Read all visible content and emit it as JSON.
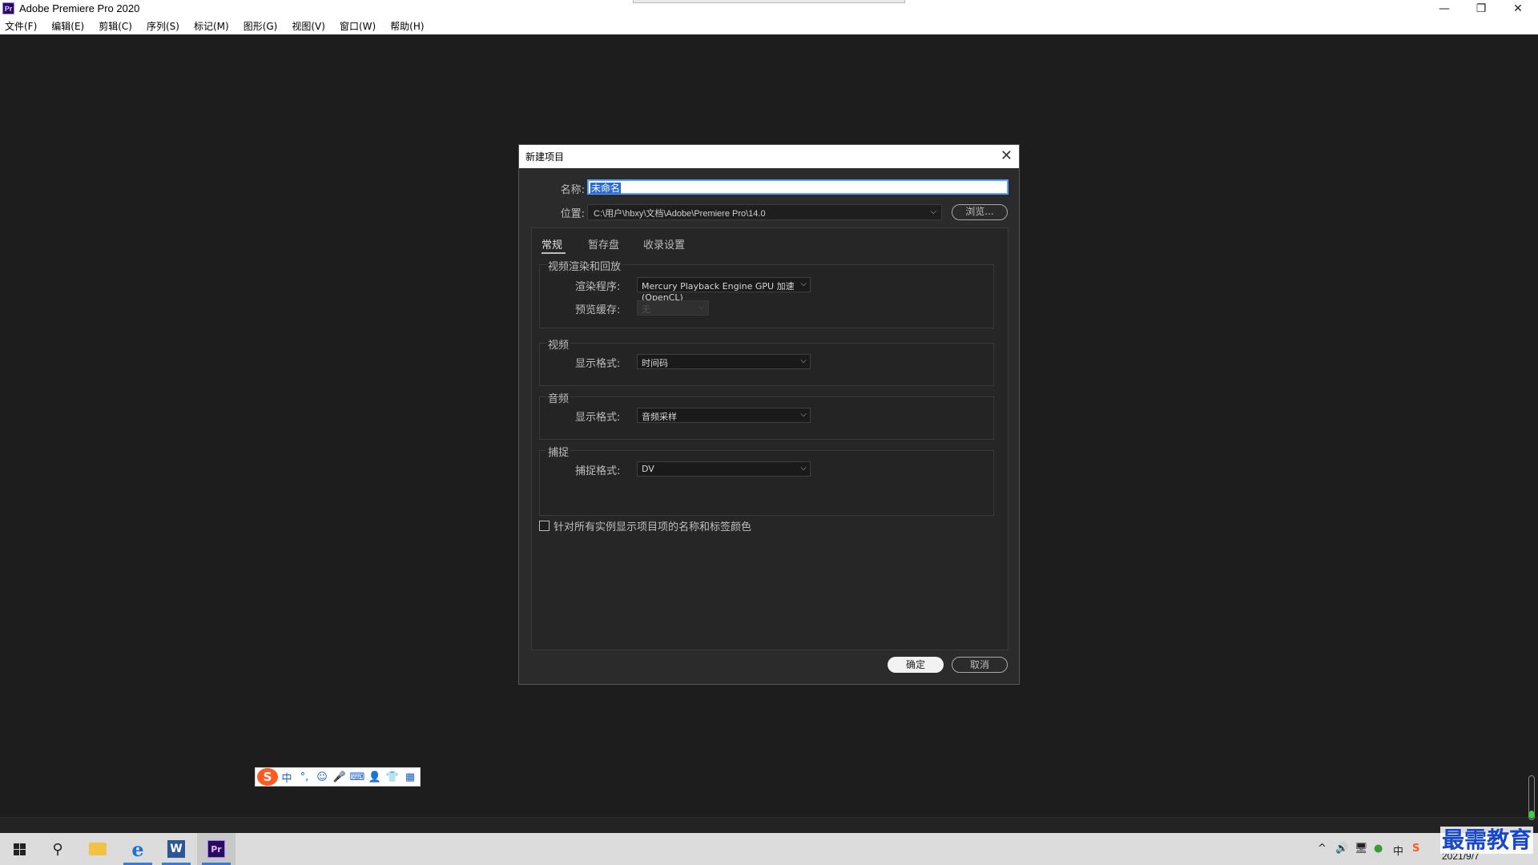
{
  "app": {
    "title": "Adobe Premiere Pro 2020",
    "logo_text": "Pr"
  },
  "menu": [
    "文件(F)",
    "编辑(E)",
    "剪辑(C)",
    "序列(S)",
    "标记(M)",
    "图形(G)",
    "视图(V)",
    "窗口(W)",
    "帮助(H)"
  ],
  "window_controls": {
    "minimize": "—",
    "restore": "❐",
    "close": "✕"
  },
  "dialog": {
    "title": "新建项目",
    "close_glyph": "✕",
    "name_label": "名称:",
    "name_value": "未命名",
    "location_label": "位置:",
    "location_value": "C:\\用户\\hbxy\\文档\\Adobe\\Premiere Pro\\14.0",
    "browse_label": "浏览...",
    "tabs": [
      "常规",
      "暂存盘",
      "收录设置"
    ],
    "groups": {
      "render": {
        "title": "视频渲染和回放",
        "renderer_label": "渲染程序:",
        "renderer_value": "Mercury Playback Engine GPU 加速 (OpenCL)",
        "preview_cache_label": "预览缓存:",
        "preview_cache_value": "无"
      },
      "video": {
        "title": "视频",
        "format_label": "显示格式:",
        "format_value": "时间码"
      },
      "audio": {
        "title": "音频",
        "format_label": "显示格式:",
        "format_value": "音频采样"
      },
      "capture": {
        "title": "捕捉",
        "format_label": "捕捉格式:",
        "format_value": "DV"
      }
    },
    "checkbox_label": "针对所有实例显示项目项的名称和标签颜色",
    "ok_label": "确定",
    "cancel_label": "取消"
  },
  "ime": {
    "logo": "S",
    "icons": [
      "中",
      "°,",
      "☺",
      "🎤",
      "⌨",
      "👤",
      "👕",
      "▦"
    ]
  },
  "taskbar": {
    "clock_date": "2021/9/7",
    "tray_icons": [
      "^",
      "🔊",
      "🖥",
      "●",
      "中",
      "S"
    ]
  },
  "watermark": "最需教育",
  "colors": {
    "accent": "#3a7bd5",
    "premiere": "#2a0a5c",
    "dialog_bg": "#2b2b2b"
  }
}
